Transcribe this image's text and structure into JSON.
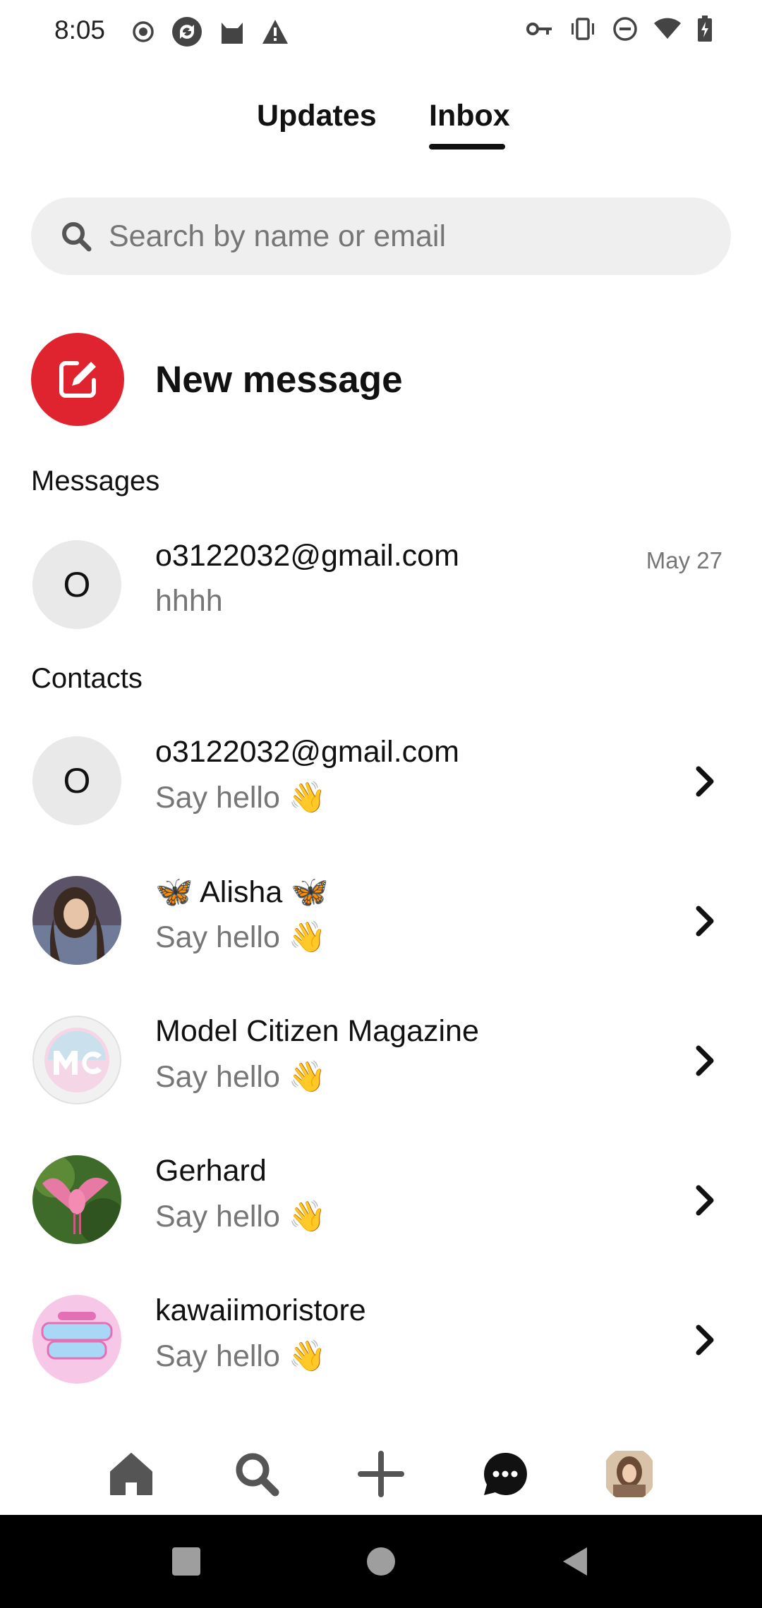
{
  "status_bar": {
    "time": "8:05",
    "left_icons": [
      "record-icon",
      "sync-icon",
      "cat-icon",
      "warning-icon"
    ],
    "right_icons": [
      "vpn-key-icon",
      "vibrate-icon",
      "do-not-disturb-icon",
      "wifi-icon",
      "battery-charging-icon"
    ]
  },
  "tabs": [
    {
      "label": "Updates",
      "active": false
    },
    {
      "label": "Inbox",
      "active": true
    }
  ],
  "search": {
    "placeholder": "Search by name or email",
    "value": ""
  },
  "new_message": {
    "label": "New message",
    "accent": "#e0242f"
  },
  "messages": {
    "header": "Messages",
    "items": [
      {
        "initial": "O",
        "name": "o3122032@gmail.com",
        "preview": "hhhh",
        "date": "May 27"
      }
    ]
  },
  "contacts": {
    "header": "Contacts",
    "items": [
      {
        "initial": "O",
        "name": "o3122032@gmail.com",
        "subtitle": "Say hello 👋",
        "avatar": "initial"
      },
      {
        "name": "🦋 Alisha 🦋",
        "subtitle": "Say hello 👋",
        "avatar": "photo-person"
      },
      {
        "name": "Model Citizen Magazine",
        "subtitle": "Say hello 👋",
        "avatar": "logo-mc"
      },
      {
        "name": "Gerhard",
        "subtitle": "Say hello 👋",
        "avatar": "photo-flamingo"
      },
      {
        "name": "kawaiimoristore",
        "subtitle": "Say hello 👋",
        "avatar": "logo-kawaii-mori"
      }
    ]
  },
  "bottom_nav": [
    "home-icon",
    "search-icon",
    "create-plus-icon",
    "messages-icon",
    "profile-avatar"
  ],
  "system_nav": [
    "recents-button",
    "home-button",
    "back-button"
  ]
}
